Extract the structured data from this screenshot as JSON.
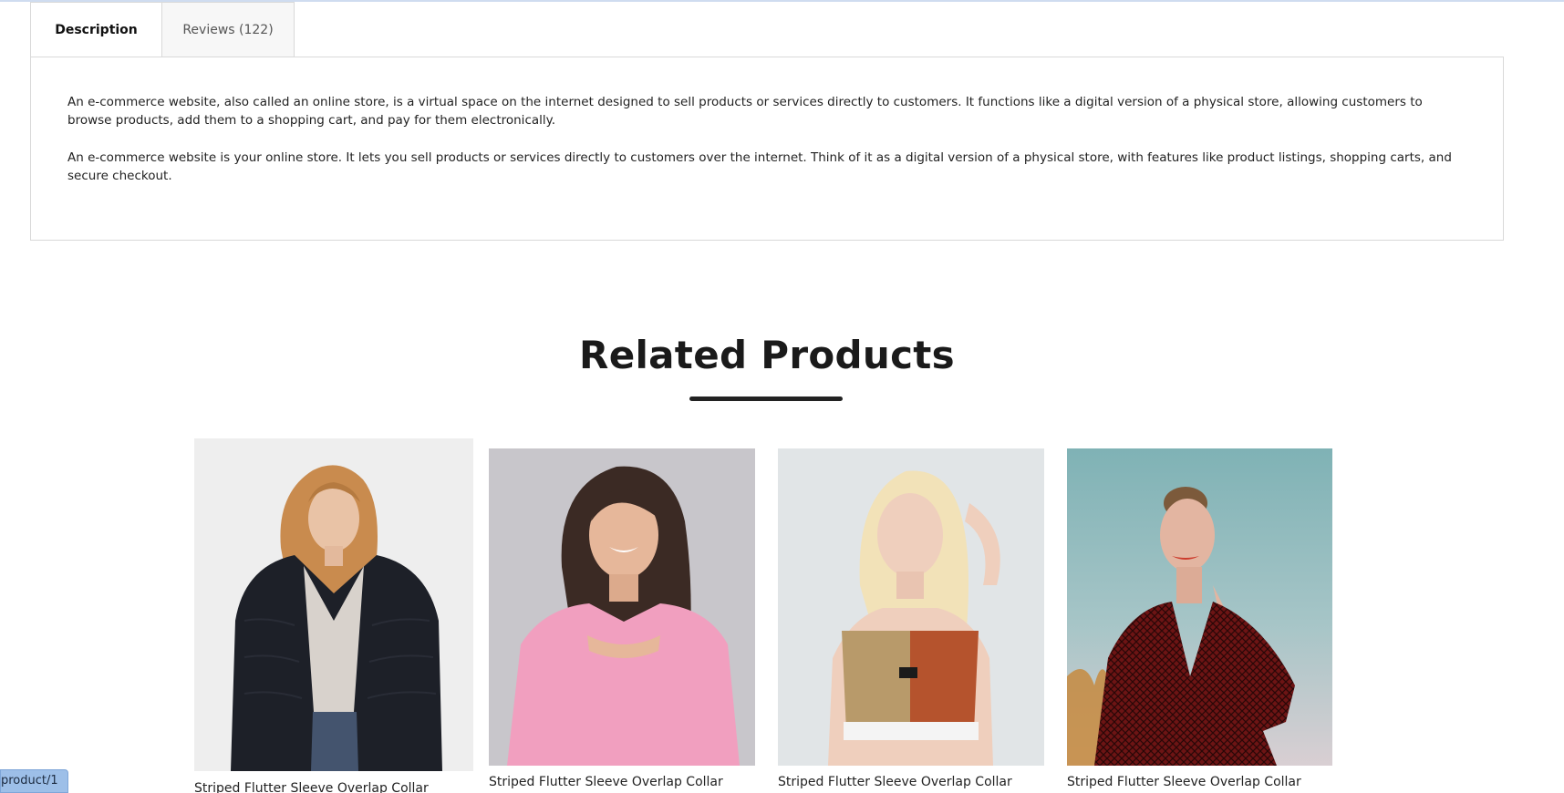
{
  "tabs": [
    {
      "label": "Description",
      "active": true
    },
    {
      "label": "Reviews (122)",
      "active": false
    }
  ],
  "description": {
    "paragraphs": [
      "An e-commerce website, also called an online store, is a virtual space on the internet designed to sell products or services directly to customers. It functions like a digital version of a physical store, allowing customers to browse products, add them to a shopping cart, and pay for them electronically.",
      "An e-commerce website is your online store. It lets you sell products or services directly to customers over the internet. Think of it as a digital version of a physical store, with features like product listings, shopping carts, and secure checkout."
    ]
  },
  "related": {
    "title": "Related Products",
    "products": [
      {
        "name": "Striped Flutter Sleeve Overlap Collar",
        "image": "woman-black-fur-jacket"
      },
      {
        "name": "Striped Flutter Sleeve Overlap Collar",
        "image": "woman-pink-top"
      },
      {
        "name": "Striped Flutter Sleeve Overlap Collar",
        "image": "woman-sports-crop-top"
      },
      {
        "name": "Striped Flutter Sleeve Overlap Collar",
        "image": "woman-red-patterned-blouse"
      }
    ]
  },
  "status_bar": {
    "url": "product/1"
  },
  "colors": {
    "accent_line": "#cfdcf0",
    "border": "#d9d9d9",
    "title_underline": "#222222",
    "status_bg": "#9dbfe8"
  }
}
